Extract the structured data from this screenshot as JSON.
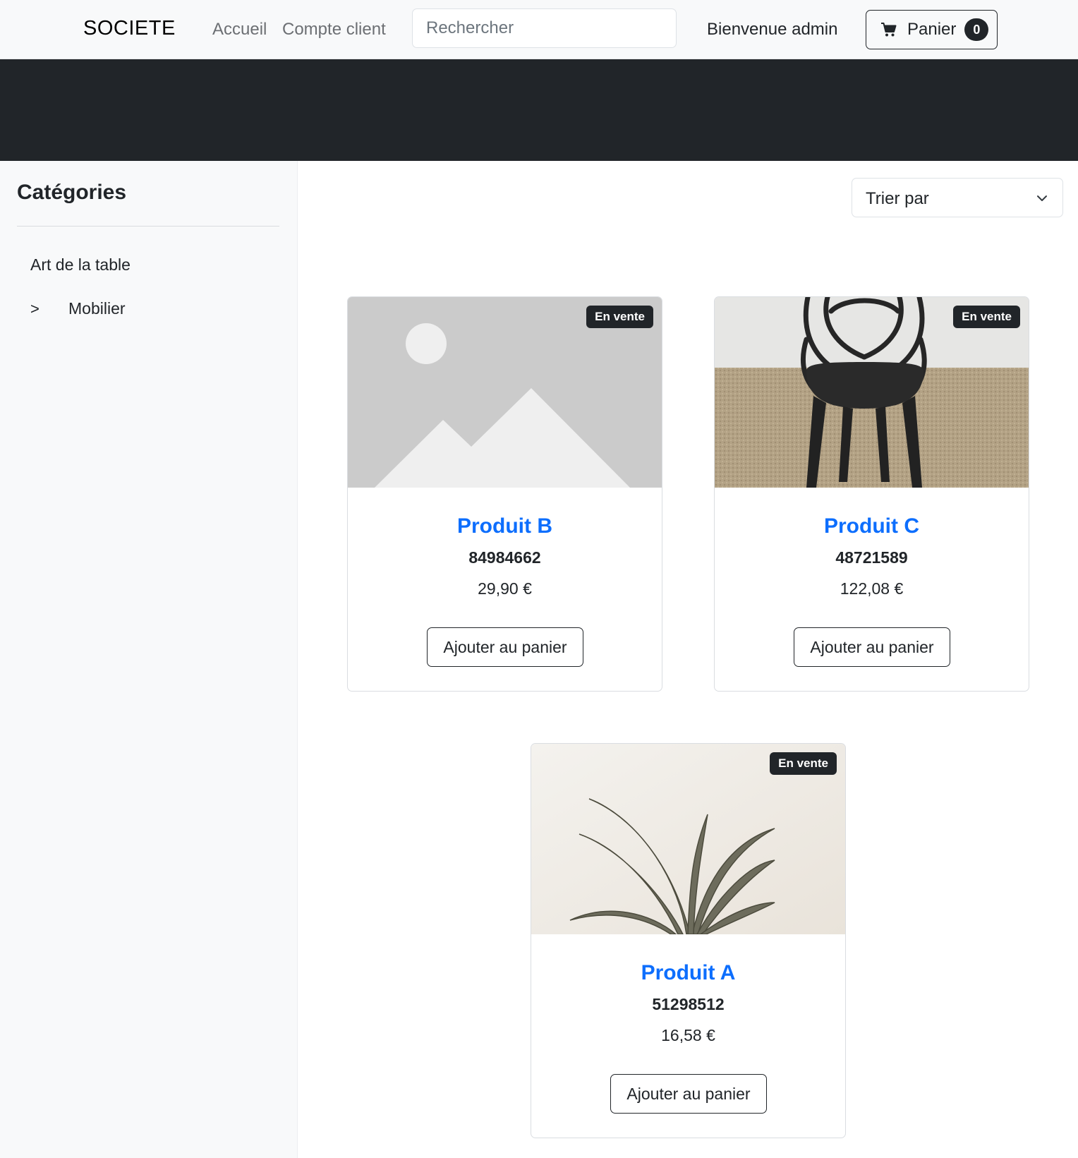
{
  "navbar": {
    "brand": "SOCIETE",
    "links": [
      "Accueil",
      "Compte client"
    ],
    "search_placeholder": "Rechercher",
    "welcome": "Bienvenue admin",
    "cart_label": "Panier",
    "cart_count": "0"
  },
  "sidebar": {
    "title": "Catégories",
    "items": [
      {
        "label": "Art de la table"
      },
      {
        "prefix": ">",
        "label": "Mobilier"
      }
    ]
  },
  "sort": {
    "label": "Trier par"
  },
  "products": [
    {
      "badge": "En vente",
      "name": "Produit B",
      "reference": "84984662",
      "price": "29,90 €",
      "button": "Ajouter au panier",
      "image": "placeholder-image"
    },
    {
      "badge": "En vente",
      "name": "Produit C",
      "reference": "48721589",
      "price": "122,08 €",
      "button": "Ajouter au panier",
      "image": "black-chair-photo"
    },
    {
      "badge": "En vente",
      "name": "Produit A",
      "reference": "51298512",
      "price": "16,58 €",
      "button": "Ajouter au panier",
      "image": "plant-photo"
    }
  ],
  "icons": {
    "cart": "cart-icon",
    "sort": "chevron-down-icon"
  },
  "colors": {
    "accent": "#0d6efd",
    "dark": "#212529",
    "navbar_bg": "#f8f9fa"
  }
}
